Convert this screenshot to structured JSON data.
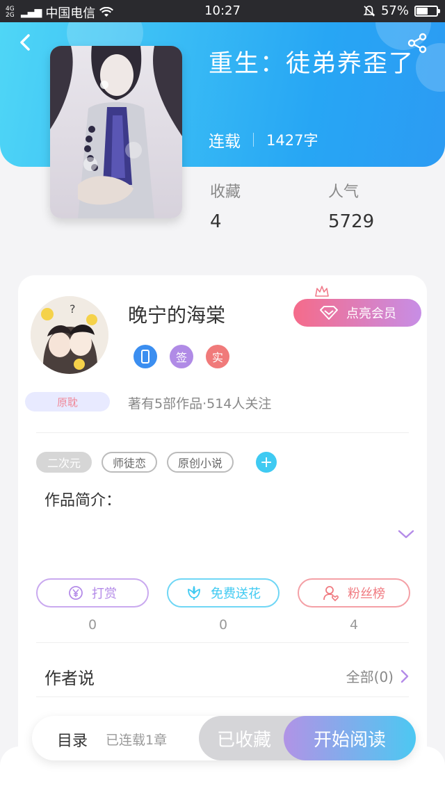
{
  "status_bar": {
    "network": "4G 2G",
    "carrier": "中国电信",
    "time": "10:27",
    "battery": "57%",
    "battery_level": 0.57
  },
  "book": {
    "title": "重生：徒弟养歪了",
    "status": "连载",
    "word_count": "1427字",
    "stats": [
      {
        "label": "收藏",
        "value": "4"
      },
      {
        "label": "人气",
        "value": "5729"
      }
    ]
  },
  "author": {
    "name": "晚宁的海棠",
    "vip_button": "点亮会员",
    "badges": [
      {
        "icon": "phone-icon",
        "text": "",
        "color": "#3b8ef0"
      },
      {
        "icon": "sign-badge",
        "text": "签",
        "color": "#b08be6"
      },
      {
        "icon": "verified-badge",
        "text": "实",
        "color": "#f07a7a"
      }
    ],
    "tag": "原耽",
    "works_info": "著有5部作品·514人关注"
  },
  "tags": [
    {
      "label": "二次元",
      "filled": true
    },
    {
      "label": "师徒恋",
      "filled": false
    },
    {
      "label": "原创小说",
      "filled": false
    }
  ],
  "intro_label": "作品简介：",
  "actions": [
    {
      "label": "打赏",
      "count": "0",
      "icon": "yen-icon",
      "color": "#b48be8"
    },
    {
      "label": "免费送花",
      "count": "0",
      "icon": "flower-icon",
      "color": "#3fcaf2"
    },
    {
      "label": "粉丝榜",
      "count": "4",
      "icon": "fans-icon",
      "color": "#f07a80"
    }
  ],
  "author_says": {
    "label": "作者说",
    "all": "全部(0)"
  },
  "bottom_bar": {
    "toc": "目录",
    "chapters": "已连载1章",
    "favorited": "已收藏",
    "read": "开始阅读"
  },
  "colors": {
    "header_start": "#4fd6f6",
    "header_end": "#2c9bf3",
    "vip_start": "#f56b8a",
    "vip_end": "#c78ee6"
  }
}
